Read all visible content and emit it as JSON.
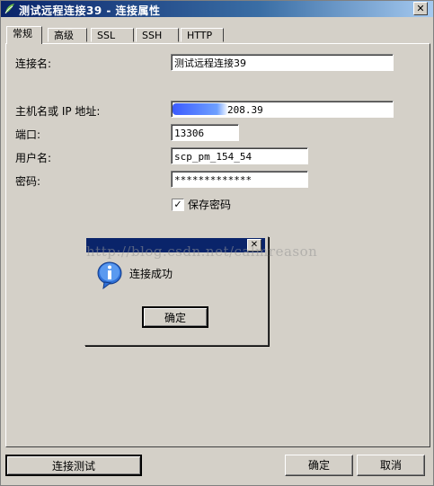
{
  "window": {
    "title": "测试远程连接39 - 连接属性",
    "close_glyph": "✕"
  },
  "tabs": [
    {
      "label": "常规"
    },
    {
      "label": "高级"
    },
    {
      "label": "SSL"
    },
    {
      "label": "SSH"
    },
    {
      "label": "HTTP"
    }
  ],
  "form": {
    "connection_name_label": "连接名:",
    "connection_name_value": "测试远程连接39",
    "host_label": "主机名或 IP 地址:",
    "host_value": "208.39",
    "port_label": "端口:",
    "port_value": "13306",
    "username_label": "用户名:",
    "username_value": "scp_pm_154_54",
    "password_label": "密码:",
    "password_value": "*************",
    "save_password_label": "保存密码",
    "save_password_checked": "✓"
  },
  "message_box": {
    "close_glyph": "✕",
    "text": "连接成功",
    "ok_label": "确定"
  },
  "watermark": "http://blog.csdn.net/calmreason",
  "footer": {
    "test_label": "连接测试",
    "ok_label": "确定",
    "cancel_label": "取消"
  },
  "colors": {
    "titlebar": "#0a246a",
    "face": "#d4d0c8"
  }
}
